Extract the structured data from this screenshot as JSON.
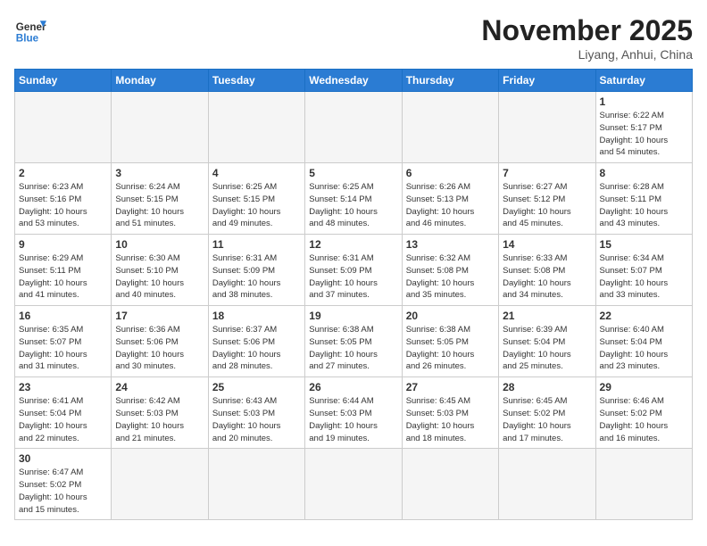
{
  "header": {
    "logo_general": "General",
    "logo_blue": "Blue",
    "month_title": "November 2025",
    "location": "Liyang, Anhui, China"
  },
  "weekdays": [
    "Sunday",
    "Monday",
    "Tuesday",
    "Wednesday",
    "Thursday",
    "Friday",
    "Saturday"
  ],
  "weeks": [
    [
      {
        "day": "",
        "info": ""
      },
      {
        "day": "",
        "info": ""
      },
      {
        "day": "",
        "info": ""
      },
      {
        "day": "",
        "info": ""
      },
      {
        "day": "",
        "info": ""
      },
      {
        "day": "",
        "info": ""
      },
      {
        "day": "1",
        "info": "Sunrise: 6:22 AM\nSunset: 5:17 PM\nDaylight: 10 hours\nand 54 minutes."
      }
    ],
    [
      {
        "day": "2",
        "info": "Sunrise: 6:23 AM\nSunset: 5:16 PM\nDaylight: 10 hours\nand 53 minutes."
      },
      {
        "day": "3",
        "info": "Sunrise: 6:24 AM\nSunset: 5:15 PM\nDaylight: 10 hours\nand 51 minutes."
      },
      {
        "day": "4",
        "info": "Sunrise: 6:25 AM\nSunset: 5:15 PM\nDaylight: 10 hours\nand 49 minutes."
      },
      {
        "day": "5",
        "info": "Sunrise: 6:25 AM\nSunset: 5:14 PM\nDaylight: 10 hours\nand 48 minutes."
      },
      {
        "day": "6",
        "info": "Sunrise: 6:26 AM\nSunset: 5:13 PM\nDaylight: 10 hours\nand 46 minutes."
      },
      {
        "day": "7",
        "info": "Sunrise: 6:27 AM\nSunset: 5:12 PM\nDaylight: 10 hours\nand 45 minutes."
      },
      {
        "day": "8",
        "info": "Sunrise: 6:28 AM\nSunset: 5:11 PM\nDaylight: 10 hours\nand 43 minutes."
      }
    ],
    [
      {
        "day": "9",
        "info": "Sunrise: 6:29 AM\nSunset: 5:11 PM\nDaylight: 10 hours\nand 41 minutes."
      },
      {
        "day": "10",
        "info": "Sunrise: 6:30 AM\nSunset: 5:10 PM\nDaylight: 10 hours\nand 40 minutes."
      },
      {
        "day": "11",
        "info": "Sunrise: 6:31 AM\nSunset: 5:09 PM\nDaylight: 10 hours\nand 38 minutes."
      },
      {
        "day": "12",
        "info": "Sunrise: 6:31 AM\nSunset: 5:09 PM\nDaylight: 10 hours\nand 37 minutes."
      },
      {
        "day": "13",
        "info": "Sunrise: 6:32 AM\nSunset: 5:08 PM\nDaylight: 10 hours\nand 35 minutes."
      },
      {
        "day": "14",
        "info": "Sunrise: 6:33 AM\nSunset: 5:08 PM\nDaylight: 10 hours\nand 34 minutes."
      },
      {
        "day": "15",
        "info": "Sunrise: 6:34 AM\nSunset: 5:07 PM\nDaylight: 10 hours\nand 33 minutes."
      }
    ],
    [
      {
        "day": "16",
        "info": "Sunrise: 6:35 AM\nSunset: 5:07 PM\nDaylight: 10 hours\nand 31 minutes."
      },
      {
        "day": "17",
        "info": "Sunrise: 6:36 AM\nSunset: 5:06 PM\nDaylight: 10 hours\nand 30 minutes."
      },
      {
        "day": "18",
        "info": "Sunrise: 6:37 AM\nSunset: 5:06 PM\nDaylight: 10 hours\nand 28 minutes."
      },
      {
        "day": "19",
        "info": "Sunrise: 6:38 AM\nSunset: 5:05 PM\nDaylight: 10 hours\nand 27 minutes."
      },
      {
        "day": "20",
        "info": "Sunrise: 6:38 AM\nSunset: 5:05 PM\nDaylight: 10 hours\nand 26 minutes."
      },
      {
        "day": "21",
        "info": "Sunrise: 6:39 AM\nSunset: 5:04 PM\nDaylight: 10 hours\nand 25 minutes."
      },
      {
        "day": "22",
        "info": "Sunrise: 6:40 AM\nSunset: 5:04 PM\nDaylight: 10 hours\nand 23 minutes."
      }
    ],
    [
      {
        "day": "23",
        "info": "Sunrise: 6:41 AM\nSunset: 5:04 PM\nDaylight: 10 hours\nand 22 minutes."
      },
      {
        "day": "24",
        "info": "Sunrise: 6:42 AM\nSunset: 5:03 PM\nDaylight: 10 hours\nand 21 minutes."
      },
      {
        "day": "25",
        "info": "Sunrise: 6:43 AM\nSunset: 5:03 PM\nDaylight: 10 hours\nand 20 minutes."
      },
      {
        "day": "26",
        "info": "Sunrise: 6:44 AM\nSunset: 5:03 PM\nDaylight: 10 hours\nand 19 minutes."
      },
      {
        "day": "27",
        "info": "Sunrise: 6:45 AM\nSunset: 5:03 PM\nDaylight: 10 hours\nand 18 minutes."
      },
      {
        "day": "28",
        "info": "Sunrise: 6:45 AM\nSunset: 5:02 PM\nDaylight: 10 hours\nand 17 minutes."
      },
      {
        "day": "29",
        "info": "Sunrise: 6:46 AM\nSunset: 5:02 PM\nDaylight: 10 hours\nand 16 minutes."
      }
    ],
    [
      {
        "day": "30",
        "info": "Sunrise: 6:47 AM\nSunset: 5:02 PM\nDaylight: 10 hours\nand 15 minutes."
      },
      {
        "day": "",
        "info": ""
      },
      {
        "day": "",
        "info": ""
      },
      {
        "day": "",
        "info": ""
      },
      {
        "day": "",
        "info": ""
      },
      {
        "day": "",
        "info": ""
      },
      {
        "day": "",
        "info": ""
      }
    ]
  ]
}
